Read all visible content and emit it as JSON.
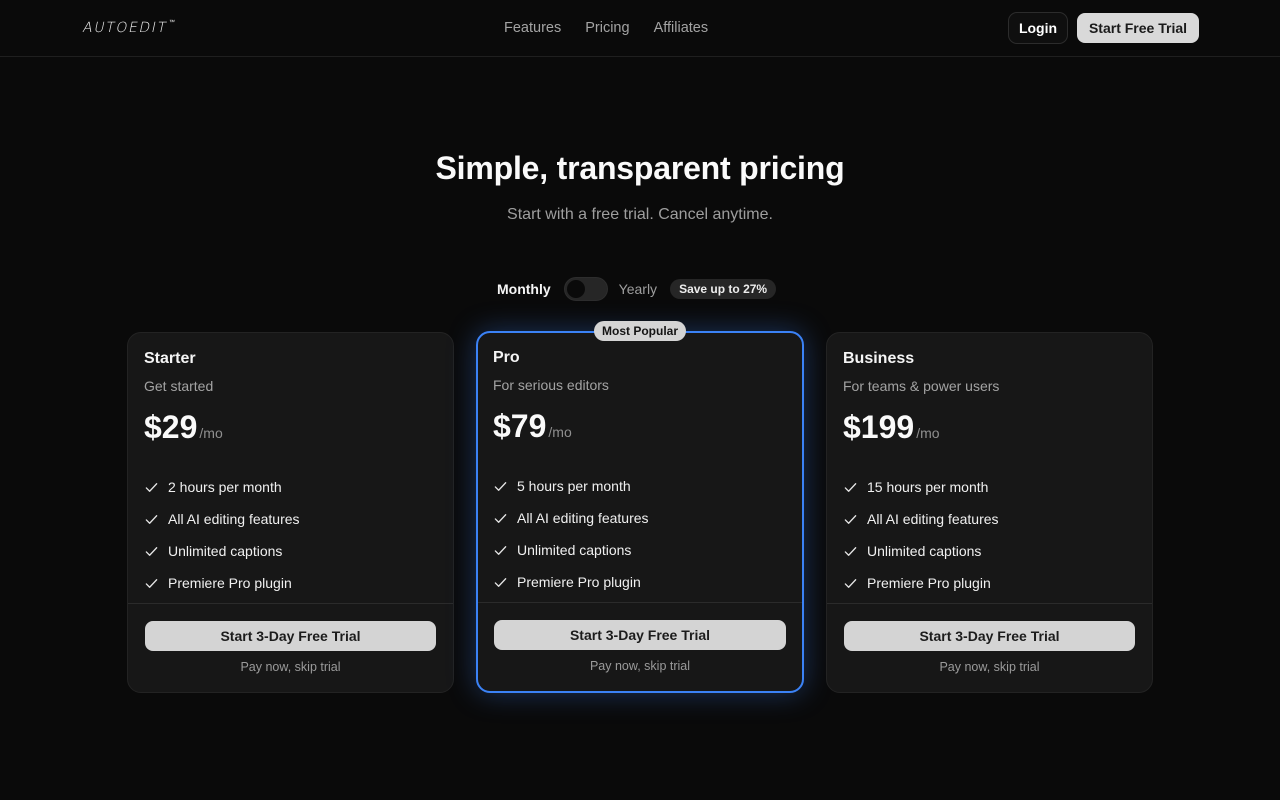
{
  "brand": {
    "logo": "AUTOEDIT",
    "trademark": "™"
  },
  "nav": {
    "features": "Features",
    "pricing": "Pricing",
    "affiliates": "Affiliates"
  },
  "header": {
    "login": "Login",
    "start_trial": "Start Free Trial"
  },
  "hero": {
    "title": "Simple, transparent pricing",
    "subtitle": "Start with a free trial. Cancel anytime."
  },
  "billing": {
    "monthly": "Monthly",
    "yearly": "Yearly",
    "selected": "Monthly",
    "save_badge": "Save up to 27%"
  },
  "accent_color": "#3b82f6",
  "plans": [
    {
      "name": "Starter",
      "description": "Get started",
      "price": "$29",
      "period": "/mo",
      "features": [
        "2 hours per month",
        "All AI editing features",
        "Unlimited captions",
        "Premiere Pro plugin"
      ],
      "cta": "Start 3-Day Free Trial",
      "skip": "Pay now, skip trial"
    },
    {
      "name": "Pro",
      "description": "For serious editors",
      "price": "$79",
      "period": "/mo",
      "badge": "Most Popular",
      "features": [
        "5 hours per month",
        "All AI editing features",
        "Unlimited captions",
        "Premiere Pro plugin"
      ],
      "cta": "Start 3-Day Free Trial",
      "skip": "Pay now, skip trial"
    },
    {
      "name": "Business",
      "description": "For teams & power users",
      "price": "$199",
      "period": "/mo",
      "features": [
        "15 hours per month",
        "All AI editing features",
        "Unlimited captions",
        "Premiere Pro plugin"
      ],
      "cta": "Start 3-Day Free Trial",
      "skip": "Pay now, skip trial"
    }
  ]
}
